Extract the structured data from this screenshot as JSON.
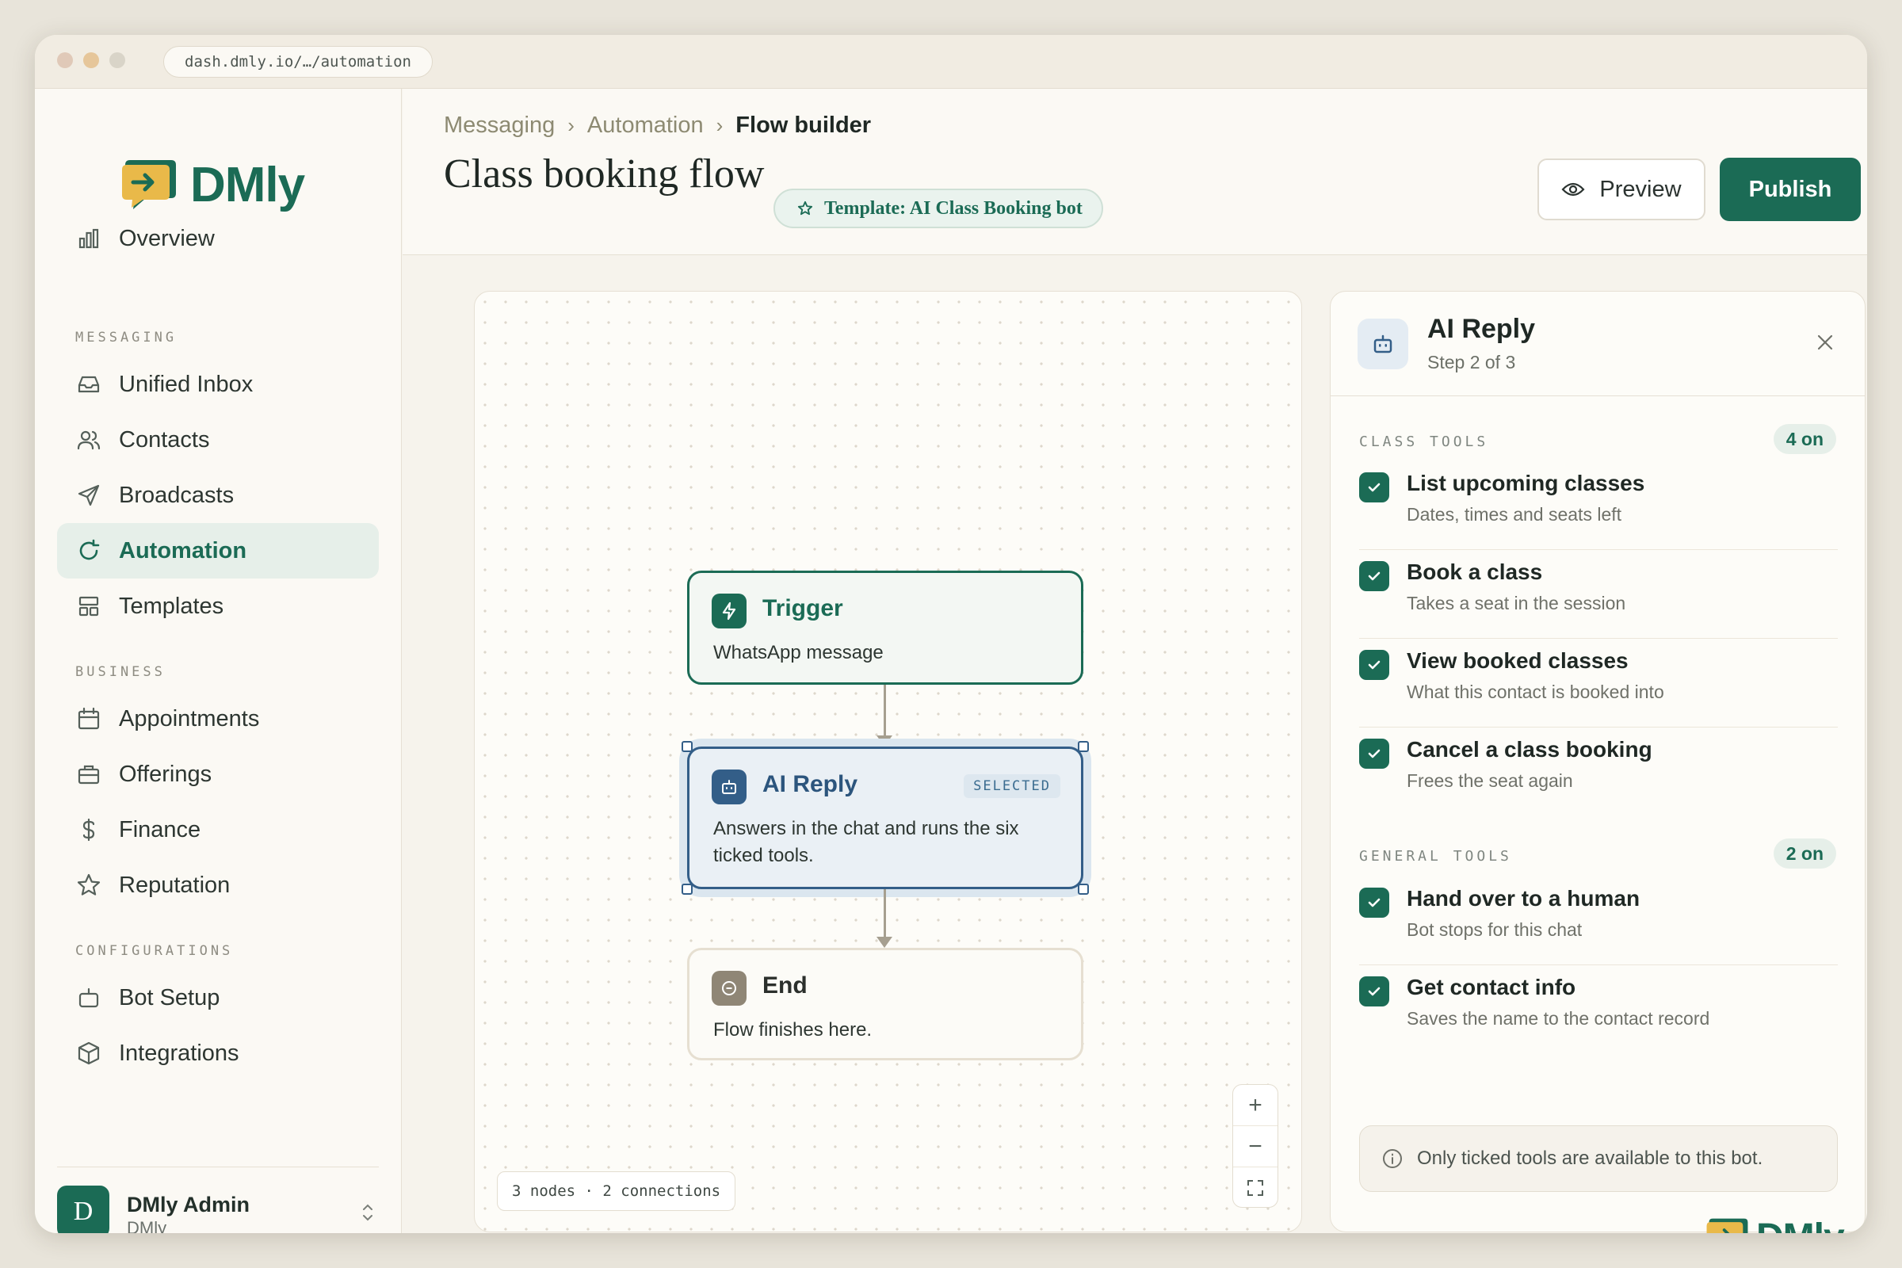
{
  "browser": {
    "url": "dash.dmly.io/…/automation",
    "traffic_lights": [
      "#e0c9b8",
      "#e6c69a",
      "#d9d4c8"
    ]
  },
  "brand": {
    "name": "DMly",
    "color": "#1b6b55"
  },
  "sidebar": {
    "overview": "Overview",
    "sections": {
      "messaging": "MESSAGING",
      "business": "BUSINESS",
      "configurations": "CONFIGURATIONS"
    },
    "items": {
      "unified_inbox": "Unified Inbox",
      "contacts": "Contacts",
      "broadcasts": "Broadcasts",
      "automation": "Automation",
      "templates": "Templates",
      "appointments": "Appointments",
      "offerings": "Offerings",
      "finance": "Finance",
      "reputation": "Reputation",
      "bot_setup": "Bot Setup",
      "integrations": "Integrations"
    },
    "active_item": "Automation",
    "user": {
      "initial": "D",
      "name": "DMly Admin",
      "org": "DMly"
    }
  },
  "header": {
    "breadcrumb": [
      "Messaging",
      "Automation",
      "Flow builder"
    ],
    "title": "Class booking flow",
    "template_badge": "Template: AI Class Booking bot",
    "preview_label": "Preview",
    "publish_label": "Publish"
  },
  "canvas": {
    "nodes": {
      "trigger": {
        "title": "Trigger",
        "desc": "WhatsApp message"
      },
      "ai": {
        "title": "AI Reply",
        "tag": "SELECTED",
        "desc": "Answers in the chat and runs the six ticked tools."
      },
      "end": {
        "title": "End",
        "desc": "Flow finishes here."
      }
    },
    "stats": "3 nodes · 2 connections",
    "zoom": {
      "in": "+",
      "out": "−"
    }
  },
  "panel": {
    "title": "AI Reply",
    "subtitle": "Step 2 of 3",
    "class_tools": {
      "label": "CLASS TOOLS",
      "count": "4 on",
      "items": [
        {
          "name": "List upcoming classes",
          "desc": "Dates, times and seats left"
        },
        {
          "name": "Book a class",
          "desc": "Takes a seat in the session"
        },
        {
          "name": "View booked classes",
          "desc": "What this contact is booked into"
        },
        {
          "name": "Cancel a class booking",
          "desc": "Frees the seat again"
        }
      ]
    },
    "general_tools": {
      "label": "GENERAL TOOLS",
      "count": "2 on",
      "items": [
        {
          "name": "Hand over to a human",
          "desc": "Bot stops for this chat"
        },
        {
          "name": "Get contact info",
          "desc": "Saves the name to the contact record"
        }
      ]
    },
    "info": "Only ticked tools are available to this bot."
  }
}
